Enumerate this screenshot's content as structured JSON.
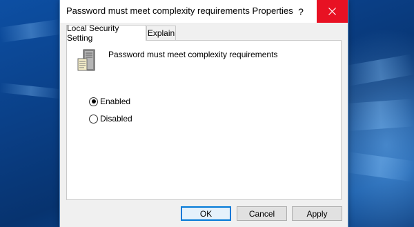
{
  "window": {
    "title": "Password must meet complexity requirements Properties",
    "help_glyph": "?",
    "close_glyph": "×"
  },
  "tabs": [
    {
      "label": "Local Security Setting",
      "active": true
    },
    {
      "label": "Explain",
      "active": false
    }
  ],
  "policy": {
    "icon": "server-policy-icon",
    "name": "Password must meet complexity requirements"
  },
  "options": {
    "selected": "Enabled",
    "enabled_label": "Enabled",
    "disabled_label": "Disabled"
  },
  "buttons": {
    "ok": "OK",
    "cancel": "Cancel",
    "apply": "Apply"
  },
  "colors": {
    "close_bg": "#e81123",
    "accent": "#0078d7"
  }
}
